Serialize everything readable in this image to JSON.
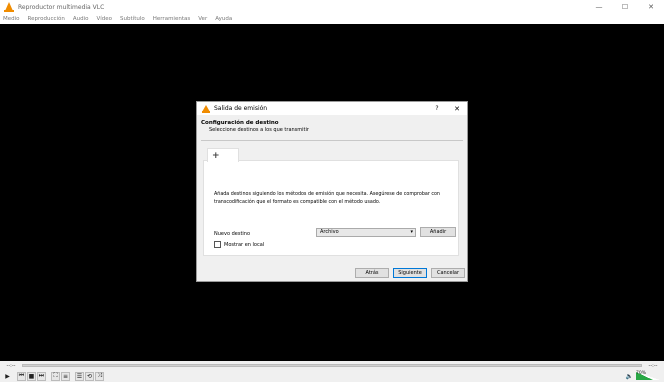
{
  "window": {
    "title": "Reproductor multimedia VLC",
    "controls": [
      "—",
      "☐",
      "✕"
    ]
  },
  "menu": [
    "Medio",
    "Reproducción",
    "Audio",
    "Vídeo",
    "Subtítulo",
    "Herramientas",
    "Ver",
    "Ayuda"
  ],
  "dialog": {
    "title": "Salida de emisión",
    "help": "?",
    "close": "✕",
    "header_title": "Configuración de destino",
    "header_subtitle": "Seleccione destinos a los que transmitir",
    "add_tab_icon": "+",
    "description": "Añada destinos siguiendo los métodos de emisión que necesita. Asegúrese de comprobar con transcodificación que el formato es compatible con el método usado.",
    "new_destination_label": "Nuevo destino",
    "destination_value": "Archivo",
    "add_button": "Añadir",
    "show_local_label": "Mostrar en local",
    "show_local_checked": false,
    "back_button": "Atrás",
    "next_button": "Siguiente",
    "cancel_button": "Cancelar"
  },
  "player": {
    "time_elapsed": "--:--",
    "time_total": "--:--",
    "volume_text": "70%",
    "volume_level": 0.7
  }
}
